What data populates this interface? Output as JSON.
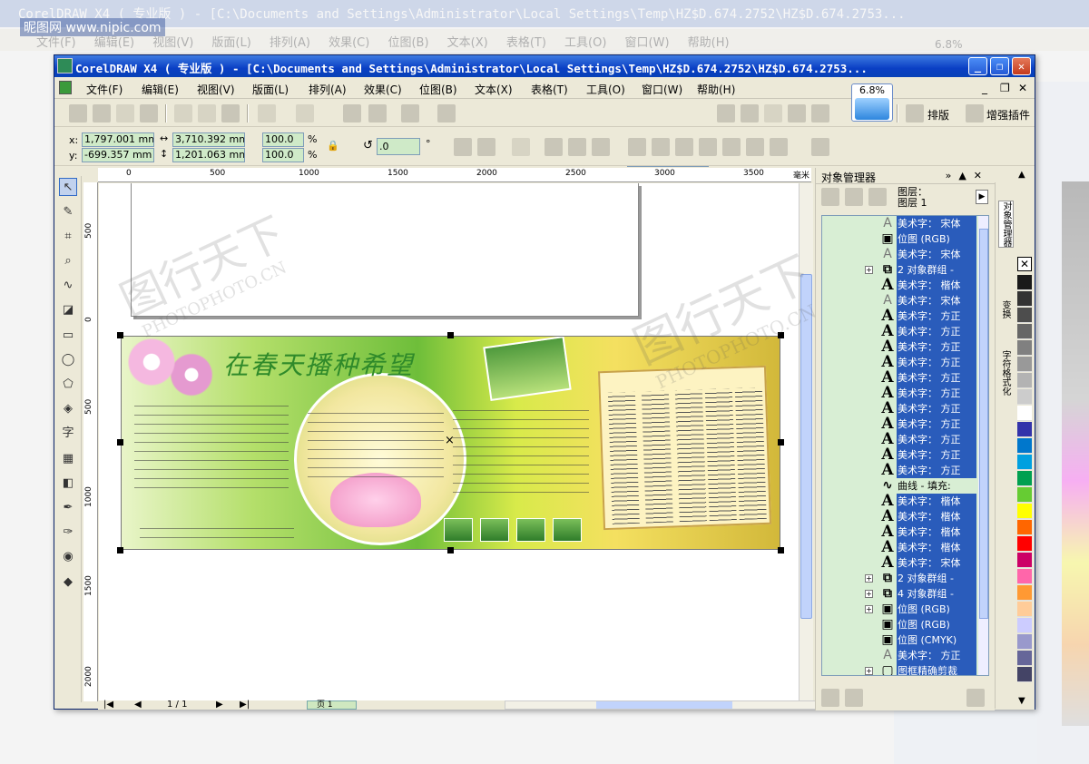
{
  "background": {
    "title": "CorelDRAW X4 ( 专业版 ) - [C:\\Documents and Settings\\Administrator\\Local Settings\\Temp\\HZ$D.674.2752\\HZ$D.674.2753...",
    "menu": "文件(F) 编辑(E) 视图(V) 版面(L) 排列(A) 效果(C) 位图(B) 文本(X) 表格(T) 工具(O) 窗口(W) 帮助(H)",
    "zoom_badge": "6.8%"
  },
  "window": {
    "title": "CorelDRAW X4 ( 专业版 ) - [C:\\Documents and Settings\\Administrator\\Local Settings\\Temp\\HZ$D.674.2752\\HZ$D.674.2753...",
    "min": "_",
    "max": "❐",
    "close": "✕"
  },
  "menu": [
    "文件(F)",
    "编辑(E)",
    "视图(V)",
    "版面(L)",
    "排列(A)",
    "效果(C)",
    "位图(B)",
    "文本(X)",
    "表格(T)",
    "工具(O)",
    "窗口(W)",
    "帮助(H)"
  ],
  "mdi_controls": [
    "_",
    "❐",
    "✕"
  ],
  "zoom_badge": "6.8%",
  "toolbar": {
    "zoom_value": "6%",
    "layout_label": "排版",
    "plugin_label": "增强插件"
  },
  "property_bar": {
    "x_label": "x:",
    "y_label": "y:",
    "x_value": "1,797.001 mm",
    "y_value": "-699.357 mm",
    "width_value": "3,710.392 mm",
    "height_value": "1,201.063 mm",
    "scale_x": "100.0",
    "scale_y": "100.0",
    "percent": "%",
    "rotation": ".0",
    "degree": "°"
  },
  "ruler": {
    "h_ticks": [
      "0",
      "500",
      "1000",
      "1500",
      "2000",
      "2500",
      "3000",
      "3500"
    ],
    "h_unit": "毫米",
    "v_ticks": [
      "500",
      "0",
      "500",
      "1000",
      "1500",
      "2000"
    ]
  },
  "artwork": {
    "title": "在春天播种希望"
  },
  "page_nav": {
    "counter": "1 / 1",
    "tab": "页 1"
  },
  "docker": {
    "title": "对象管理器",
    "layer_label": "图层：",
    "layer_name": "图层 1",
    "objects": [
      {
        "icon": "A",
        "style": "thin",
        "name": "美术字： 宋体",
        "expand": false
      },
      {
        "icon": "▣",
        "style": "",
        "name": "位图 (RGB)",
        "expand": false
      },
      {
        "icon": "A",
        "style": "thin",
        "name": "美术字： 宋体",
        "expand": false
      },
      {
        "icon": "⧉",
        "style": "",
        "name": "2 对象群组 - ",
        "expand": true
      },
      {
        "icon": "A",
        "style": "big",
        "name": "美术字： 楷体",
        "expand": false
      },
      {
        "icon": "A",
        "style": "thin",
        "name": "美术字： 宋体",
        "expand": false
      },
      {
        "icon": "A",
        "style": "big",
        "name": "美术字： 方正",
        "expand": false
      },
      {
        "icon": "A",
        "style": "big",
        "name": "美术字： 方正",
        "expand": false
      },
      {
        "icon": "A",
        "style": "big",
        "name": "美术字： 方正",
        "expand": false
      },
      {
        "icon": "A",
        "style": "big",
        "name": "美术字： 方正",
        "expand": false
      },
      {
        "icon": "A",
        "style": "big",
        "name": "美术字： 方正",
        "expand": false
      },
      {
        "icon": "A",
        "style": "big",
        "name": "美术字： 方正",
        "expand": false
      },
      {
        "icon": "A",
        "style": "big",
        "name": "美术字： 方正",
        "expand": false
      },
      {
        "icon": "A",
        "style": "big",
        "name": "美术字： 方正",
        "expand": false
      },
      {
        "icon": "A",
        "style": "big",
        "name": "美术字： 方正",
        "expand": false
      },
      {
        "icon": "A",
        "style": "big",
        "name": "美术字： 方正",
        "expand": false
      },
      {
        "icon": "A",
        "style": "big",
        "name": "美术字： 方正",
        "expand": false
      },
      {
        "icon": "∿",
        "style": "",
        "name": "曲线 - 填充:",
        "expand": false,
        "plain": true
      },
      {
        "icon": "A",
        "style": "big",
        "name": "美术字： 楷体",
        "expand": false
      },
      {
        "icon": "A",
        "style": "big",
        "name": "美术字： 楷体",
        "expand": false
      },
      {
        "icon": "A",
        "style": "big",
        "name": "美术字： 楷体",
        "expand": false
      },
      {
        "icon": "A",
        "style": "big",
        "name": "美术字： 楷体",
        "expand": false
      },
      {
        "icon": "A",
        "style": "big",
        "name": "美术字： 宋体",
        "expand": false
      },
      {
        "icon": "⧉",
        "style": "",
        "name": "2 对象群组 - ",
        "expand": true
      },
      {
        "icon": "⧉",
        "style": "",
        "name": "4 对象群组 - ",
        "expand": true
      },
      {
        "icon": "▣",
        "style": "",
        "name": "位图 (RGB)",
        "expand": true
      },
      {
        "icon": "▣",
        "style": "",
        "name": "位图 (RGB)",
        "expand": false
      },
      {
        "icon": "▣",
        "style": "",
        "name": "位图 (CMYK)",
        "expand": false
      },
      {
        "icon": "A",
        "style": "thin",
        "name": "美术字： 方正",
        "expand": false
      },
      {
        "icon": "▢",
        "style": "",
        "name": "图框精确剪裁",
        "expand": true
      }
    ],
    "side_tabs": [
      "对象管理器",
      "变换",
      "字符格式化"
    ]
  },
  "palette": [
    "#1a1a1a",
    "#333333",
    "#4d4d4d",
    "#666666",
    "#808080",
    "#999999",
    "#b3b3b3",
    "#cccccc",
    "#ffffff",
    "#3333aa",
    "#0077cc",
    "#00a0e0",
    "#00a050",
    "#66cc33",
    "#ffff00",
    "#ff6600",
    "#ff0000",
    "#cc0066",
    "#ff66aa",
    "#ff9933",
    "#ffcc99",
    "#ccccff",
    "#9999cc",
    "#666699",
    "#444466"
  ],
  "watermark": {
    "site_small": "昵图网 www.nipic.com",
    "cn": "图行天下",
    "en": "PHOTOPHOTO.CN"
  }
}
